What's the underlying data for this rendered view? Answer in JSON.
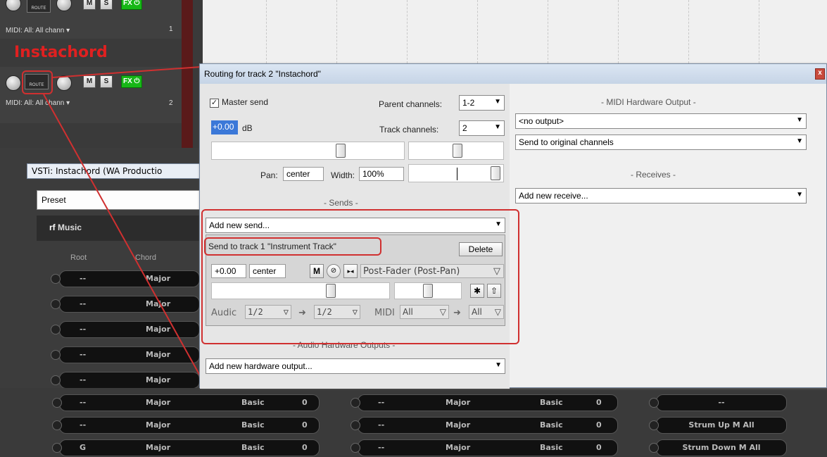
{
  "tracks": {
    "route_label": "ROUTE",
    "mute": "M",
    "solo": "S",
    "fx": "FX",
    "track1": {
      "midi": "MIDI: All: All chann",
      "number": "1"
    },
    "track2": {
      "midi": "MIDI: All: All chann",
      "number": "2",
      "name": "Instachord"
    }
  },
  "vsti": {
    "title": "VSTi: Instachord (WA Productio",
    "preset": "Preset",
    "logo": "Music",
    "col_root": "Root",
    "col_chord": "Chord",
    "rows": [
      {
        "root": "--",
        "chord": "Major"
      },
      {
        "root": "--",
        "chord": "Major"
      },
      {
        "root": "--",
        "chord": "Major"
      },
      {
        "root": "--",
        "chord": "Major"
      },
      {
        "root": "--",
        "chord": "Major"
      }
    ]
  },
  "bottom_rows": [
    {
      "a_root": "--",
      "a_chord": "Major",
      "a_type": "Basic",
      "a_val": "0",
      "b_root": "--",
      "b_chord": "Major",
      "b_type": "Basic",
      "b_val": "0",
      "c": "--"
    },
    {
      "a_root": "--",
      "a_chord": "Major",
      "a_type": "Basic",
      "a_val": "0",
      "b_root": "--",
      "b_chord": "Major",
      "b_type": "Basic",
      "b_val": "0",
      "c": "Strum Up M All"
    },
    {
      "a_root": "G",
      "a_chord": "Major",
      "a_type": "Basic",
      "a_val": "0",
      "b_root": "--",
      "b_chord": "Major",
      "b_type": "Basic",
      "b_val": "0",
      "c": "Strum Down M All"
    }
  ],
  "dialog": {
    "title": "Routing for track 2 \"Instachord\"",
    "close": "x",
    "master_send": "Master send",
    "parent_channels_label": "Parent channels:",
    "parent_channels_value": "1-2",
    "track_channels_label": "Track channels:",
    "track_channels_value": "2",
    "volume_value": "+0.00",
    "volume_unit": "dB",
    "pan_label": "Pan:",
    "pan_value": "center",
    "width_label": "Width:",
    "width_value": "100%",
    "midi_hw_header": "- MIDI Hardware Output -",
    "midi_output": "<no output>",
    "send_to": "Send to original channels",
    "receives_header": "- Receives -",
    "add_receive": "Add new receive...",
    "sends_header": "- Sends -",
    "add_send": "Add new send...",
    "send_name": "Send to track 1 \"Instrument Track\"",
    "delete": "Delete",
    "send_vol": "+0.00",
    "send_pan": "center",
    "send_mute": "M",
    "send_mode": "Post-Fader (Post-Pan)",
    "audio_label": "Audic",
    "audio_src": "1/2",
    "audio_dst": "1/2",
    "midi_label": "MIDI",
    "midi_src": "All",
    "midi_dst": "All",
    "hw_header": "- Audio Hardware Outputs -",
    "add_hw": "Add new hardware output..."
  }
}
